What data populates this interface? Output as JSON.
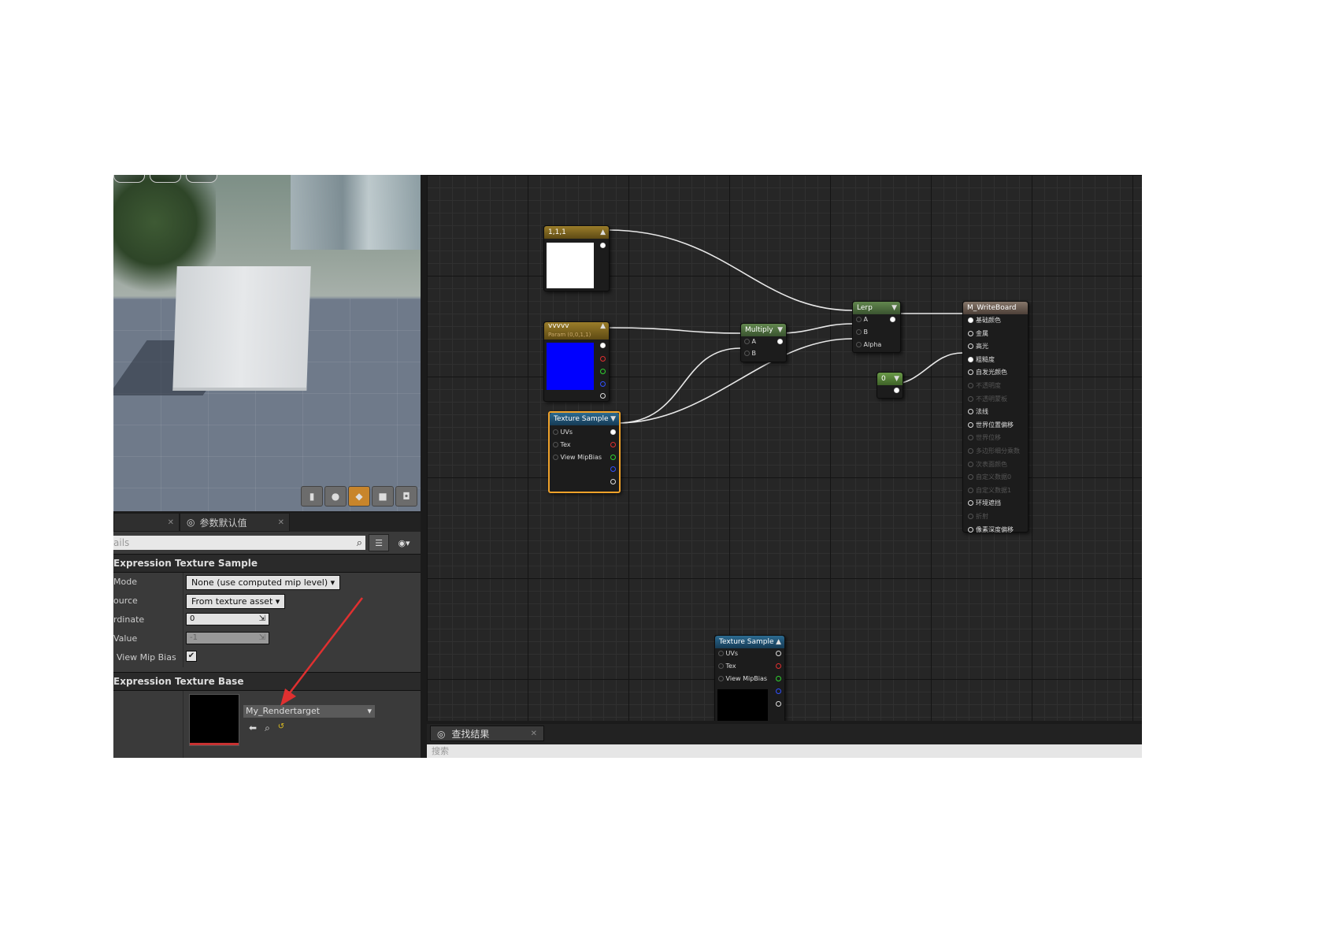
{
  "details": {
    "tabs": [
      {
        "label": ""
      },
      {
        "label": "参数默认值"
      }
    ],
    "search_placeholder": "ails",
    "categories": {
      "texture_sample": "Expression Texture Sample",
      "texture_base": "Expression Texture Base"
    },
    "props": [
      {
        "label": "Mode",
        "value": "None (use computed mip level)"
      },
      {
        "label": "ource",
        "value": "From texture asset"
      },
      {
        "label": "rdinate",
        "value": "0"
      },
      {
        "label": "Value",
        "value": "-1"
      },
      {
        "label": "View Mip Bias",
        "checked": true
      }
    ],
    "texture_asset": "My_Rendertarget"
  },
  "graph": {
    "nodes": {
      "const3": {
        "title": "1,1,1",
        "color": "#ffffff"
      },
      "param": {
        "title": "vvvvv",
        "subtitle": "Param (0,0,1,1)",
        "color": "#0000ff"
      },
      "texsample1": {
        "title": "Texture Sample",
        "pins": [
          "UVs",
          "Tex",
          "View MipBias"
        ]
      },
      "multiply": {
        "title": "Multiply",
        "pins": [
          "A",
          "B"
        ]
      },
      "lerp": {
        "title": "Lerp",
        "pins": [
          "A",
          "B",
          "Alpha"
        ]
      },
      "const0": {
        "title": "0"
      },
      "texsample2": {
        "title": "Texture Sample",
        "pins": [
          "UVs",
          "Tex",
          "View MipBias"
        ]
      },
      "material": {
        "title": "M_WriteBoard",
        "pins": [
          "基础颜色",
          "金属",
          "高光",
          "粗糙度",
          "自发光颜色",
          "不透明度",
          "不透明蒙板",
          "法线",
          "世界位置偏移",
          "世界位移",
          "多边形细分乘数",
          "次表面颜色",
          "自定义数据0",
          "自定义数据1",
          "环境遮挡",
          "折射",
          "像素深度偏移"
        ]
      }
    }
  },
  "find": {
    "tab_label": "查找结果",
    "search_placeholder": "搜索"
  },
  "colors": {
    "selection": "#f0a22a",
    "const_header": "#7a6420",
    "texture_header": "#1e4f6e",
    "math_header": "#4b6a3e",
    "material_header": "#6b5a4e"
  }
}
